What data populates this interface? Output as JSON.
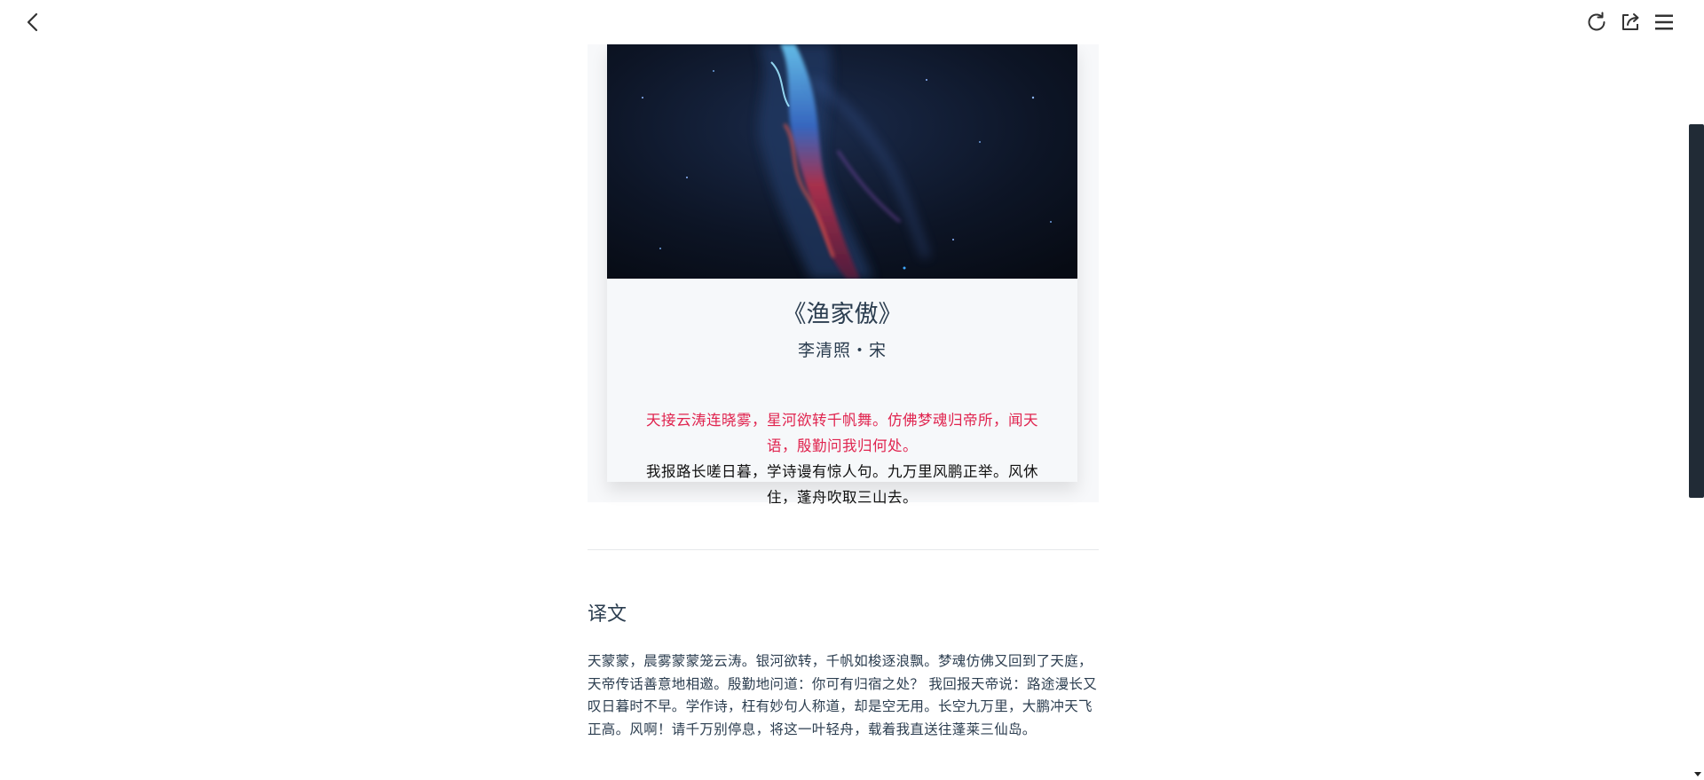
{
  "toolbar": {
    "back_icon": "chevron-left-icon",
    "refresh_icon": "refresh-icon",
    "share_icon": "share-icon",
    "menu_icon": "hamburger-menu-icon"
  },
  "poem": {
    "image_description_icon": "nebula-artwork",
    "title": "《渔家傲》",
    "author": "李清照・宋",
    "highlight_line": "天接云涛连晓雾，星河欲转千帆舞。仿佛梦魂归帝所，闻天语，殷勤问我归何处。",
    "second_line": "我报路长嗟日暮，学诗谩有惊人句。九万里风鹏正举。风休住，蓬舟吹取三山去。"
  },
  "translation_section": {
    "title": "译文",
    "text": "天蒙蒙，晨雾蒙蒙笼云涛。银河欲转，千帆如梭逐浪飘。梦魂仿佛又回到了天庭，天帝传话善意地相邀。殷勤地问道：你可有归宿之处？ 我回报天帝说：路途漫长又叹日暮时不早。学作诗，枉有妙句人称道，却是空无用。长空九万里，大鹏冲天飞正高。风啊！请千万别停息，将这一叶轻舟，载着我直送往蓬莱三仙岛。"
  },
  "colors": {
    "highlight": "#e0244f",
    "text_primary": "#2c3e50",
    "scroll_thumb": "#212b36"
  }
}
